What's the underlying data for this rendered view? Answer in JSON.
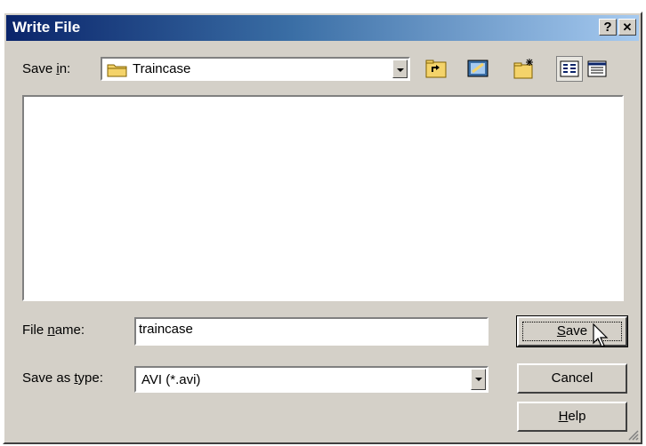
{
  "window": {
    "title": "Write File",
    "help_glyph": "?",
    "close_glyph": "✕"
  },
  "save_in": {
    "label_pre": "Save ",
    "label_key": "i",
    "label_post": "n:",
    "value": "Traincase"
  },
  "toolbar": {
    "icons": [
      "up-one-level-icon",
      "desktop-icon",
      "new-folder-icon",
      "list-view-icon",
      "details-view-icon"
    ]
  },
  "file_name": {
    "label_pre": "File ",
    "label_key": "n",
    "label_post": "ame:",
    "value": "traincase"
  },
  "save_type": {
    "label_pre": "Save as ",
    "label_key": "t",
    "label_post": "ype:",
    "value": "AVI (*.avi)"
  },
  "buttons": {
    "save_key": "S",
    "save_rest": "ave",
    "cancel": "Cancel",
    "help_key": "H",
    "help_rest": "elp"
  },
  "colors": {
    "face": "#d4d0c8",
    "title_start": "#0a246a",
    "title_end": "#a6caf0"
  }
}
